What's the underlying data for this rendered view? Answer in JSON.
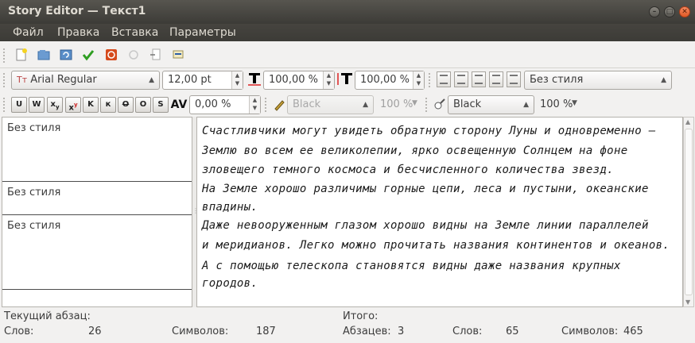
{
  "window": {
    "title": "Story Editor — Текст1"
  },
  "menu": [
    {
      "label": "Файл"
    },
    {
      "label": "Правка"
    },
    {
      "label": "Вставка"
    },
    {
      "label": "Параметры"
    }
  ],
  "toolbar1": {
    "icons": [
      "new-document-icon",
      "open-icon",
      "reload-icon",
      "apply-check-icon",
      "cancel-icon",
      "refresh-icon",
      "export-icon",
      "spellcheck-icon"
    ]
  },
  "toolbar2": {
    "font": "Arial Regular",
    "font_size": "12,00 pt",
    "scale_h": "100,00 %",
    "scale_v": "100,00 %",
    "para_style": "Без стиля"
  },
  "toolbar3": {
    "style_buttons": [
      "U",
      "W",
      "x",
      "x",
      "K",
      "к",
      "O",
      "O",
      "S"
    ],
    "tracking": "0,00 %",
    "fill_color": "Black",
    "fill_shade": "100 %",
    "stroke_color": "Black",
    "stroke_shade": "100 %"
  },
  "paragraphs": [
    {
      "style": "Без стиля"
    },
    {
      "style": "Без стиля"
    },
    {
      "style": "Без стиля"
    }
  ],
  "editor": {
    "lines": [
      "Счастливчики могут увидеть обратную сторону Луны и одновременно —",
      "Землю во всем ее великолепии, ярко освещенную Солнцем на фоне",
      "зловещего темного космоса и бесчисленного количества звезд.",
      "На Земле хорошо различимы горные цепи, леса и пустыни, океанские",
      "впадины.",
      "Даже невооруженным глазом хорошо видны на Земле линии параллелей",
      "и меридианов. Легко можно прочитать названия континентов и океанов.",
      "А с помощью телескопа становятся видны даже названия крупных",
      "городов."
    ]
  },
  "status": {
    "current_label": "Текущий абзац:",
    "words_label": "Слов:",
    "words_value": "26",
    "chars_label": "Символов:",
    "chars_value": "187",
    "total_label": "Итого:",
    "paras_label": "Абзацев:",
    "paras_value": "3",
    "total_words_label": "Слов:",
    "total_words_value": "65",
    "total_chars_label": "Символов:",
    "total_chars_value": "465"
  }
}
